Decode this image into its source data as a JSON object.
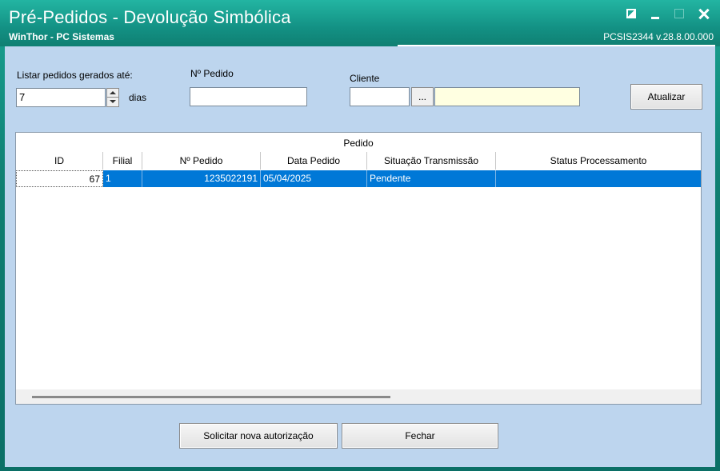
{
  "window": {
    "title": "Pré-Pedidos - Devolução Simbólica",
    "subtitle": "WinThor - PC Sistemas",
    "version": "PCSIS2344  v.28.8.00.000"
  },
  "filters": {
    "dias_label": "Listar pedidos gerados até:",
    "dias_value": "7",
    "dias_unit": "dias",
    "pedido_label": "Nº Pedido",
    "pedido_value": "",
    "cliente_label": "Cliente",
    "cliente_code": "",
    "cliente_lookup": "...",
    "cliente_name": "",
    "atualizar": "Atualizar"
  },
  "grid": {
    "band": "Pedido",
    "columns": [
      "ID",
      "Filial",
      "Nº Pedido",
      "Data Pedido",
      "Situação Transmissão",
      "Status Processamento"
    ],
    "rows": [
      {
        "id": "67",
        "filial": "1",
        "pedido": "1235022191",
        "data": "05/04/2025",
        "situacao": "Pendente",
        "status": ""
      }
    ]
  },
  "actions": {
    "solicitar": "Solicitar nova autorização",
    "fechar": "Fechar"
  }
}
